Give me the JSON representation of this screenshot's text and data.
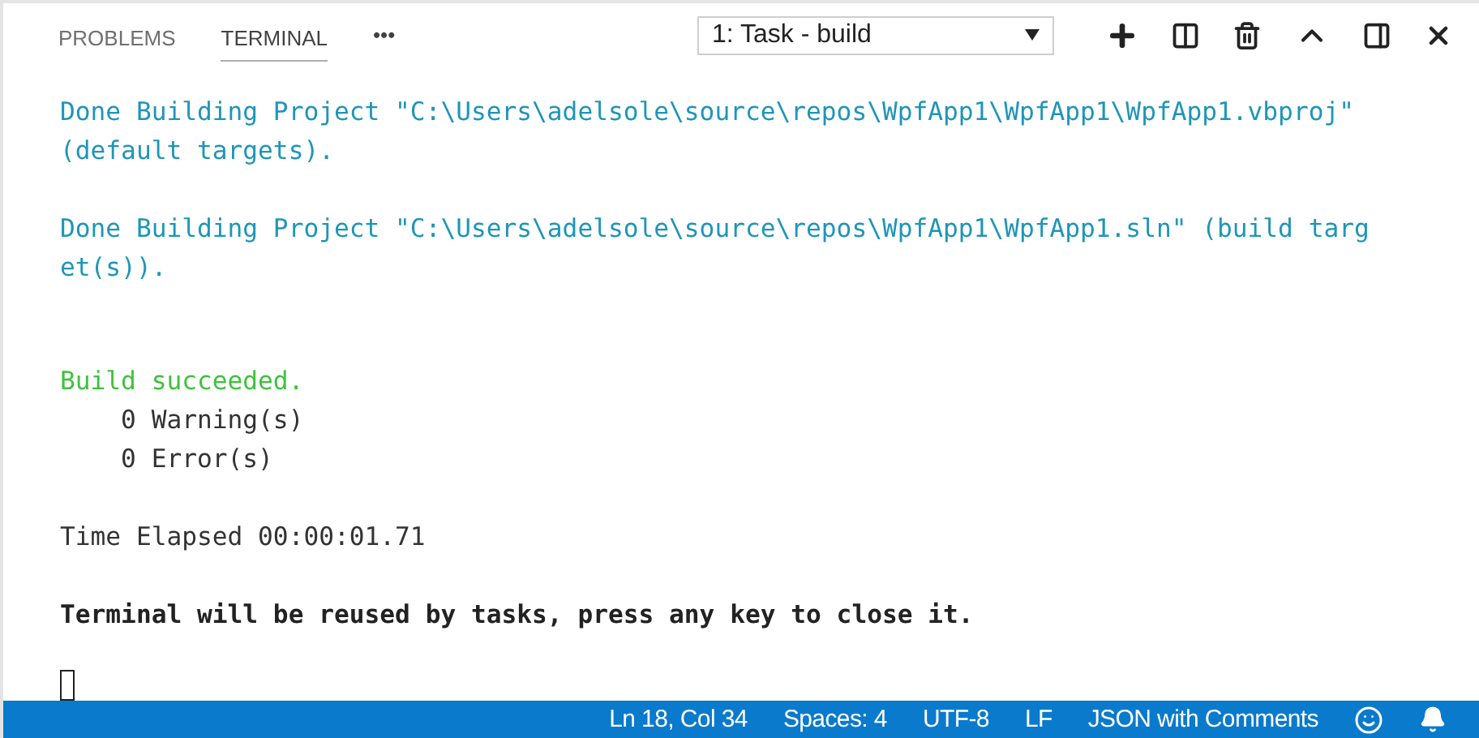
{
  "panel_tabs": [
    {
      "label": "PROBLEMS",
      "selected": false
    },
    {
      "label": "TERMINAL",
      "selected": true
    }
  ],
  "more_actions": "•••",
  "terminal_select": {
    "value": "1: Task - build"
  },
  "terminal": {
    "blocks": [
      {
        "kind": "info",
        "lines": [
          "Done Building Project \"C:\\Users\\adelsole\\source\\repos\\WpfApp1\\WpfApp1\\WpfApp1.vbproj\"",
          "(default targets)."
        ]
      },
      {
        "kind": "info",
        "lines": [
          "Done Building Project \"C:\\Users\\adelsole\\source\\repos\\WpfApp1\\WpfApp1.sln\" (build targ",
          "et(s))."
        ]
      },
      {
        "kind": "success",
        "lines": [
          "Build succeeded."
        ]
      },
      {
        "kind": "result",
        "lines": [
          "    0 Warning(s)",
          "    0 Error(s)"
        ]
      },
      {
        "kind": "plain",
        "lines": [
          "Time Elapsed 00:00:01.71"
        ]
      },
      {
        "kind": "notice",
        "lines": [
          "Terminal will be reused by tasks, press any key to close it."
        ]
      }
    ],
    "cursor": true
  },
  "status_bar": {
    "items": [
      "Ln 18, Col 34",
      "Spaces: 4",
      "UTF-8",
      "LF",
      "JSON with Comments"
    ]
  }
}
